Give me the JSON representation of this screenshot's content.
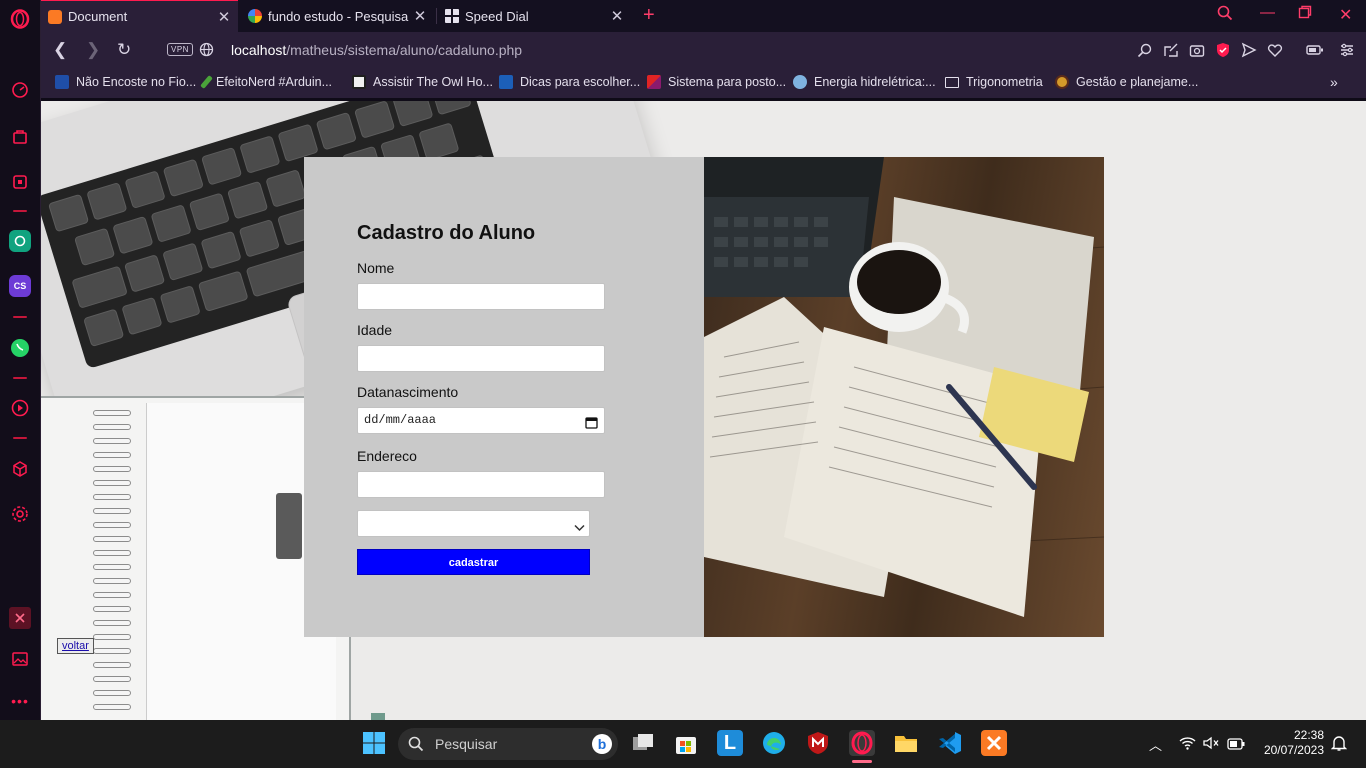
{
  "browser": {
    "tabs": [
      {
        "title": "Document",
        "active": true,
        "favicon_color": "#fb7a24"
      },
      {
        "title": "fundo estudo - Pesquisa Go",
        "active": false,
        "favicon_color": "#4285f4"
      },
      {
        "title": "Speed Dial",
        "active": false,
        "favicon_color": "#e6e2ee"
      }
    ],
    "new_tab": "+",
    "vpn_label": "VPN",
    "url_host": "localhost",
    "url_path": "/matheus/sistema/aluno/cadaluno.php",
    "accent": "#ff1b4f"
  },
  "bookmarks": [
    {
      "label": "Não Encoste no Fio..."
    },
    {
      "label": "EfeitoNerd #Arduin..."
    },
    {
      "label": "Assistir The Owl Ho..."
    },
    {
      "label": "Dicas para escolher..."
    },
    {
      "label": "Sistema para posto..."
    },
    {
      "label": "Energia hidrelétrica:..."
    },
    {
      "label": "Trigonometria"
    },
    {
      "label": "Gestão e planejame..."
    }
  ],
  "bookmarks_more": "»",
  "form": {
    "title": "Cadastro do Aluno",
    "fields": [
      {
        "label": "Nome",
        "value": ""
      },
      {
        "label": "Idade",
        "value": ""
      },
      {
        "label": "Datanascimento",
        "value": "dd/mm/aaaa"
      },
      {
        "label": "Endereco",
        "value": ""
      }
    ],
    "select_value": "",
    "submit_label": "cadastrar",
    "button_color": "#0000ff"
  },
  "page_link": {
    "label": "voltar"
  },
  "taskbar": {
    "search_placeholder": "Pesquisar",
    "time": "22:38",
    "date": "20/07/2023"
  }
}
